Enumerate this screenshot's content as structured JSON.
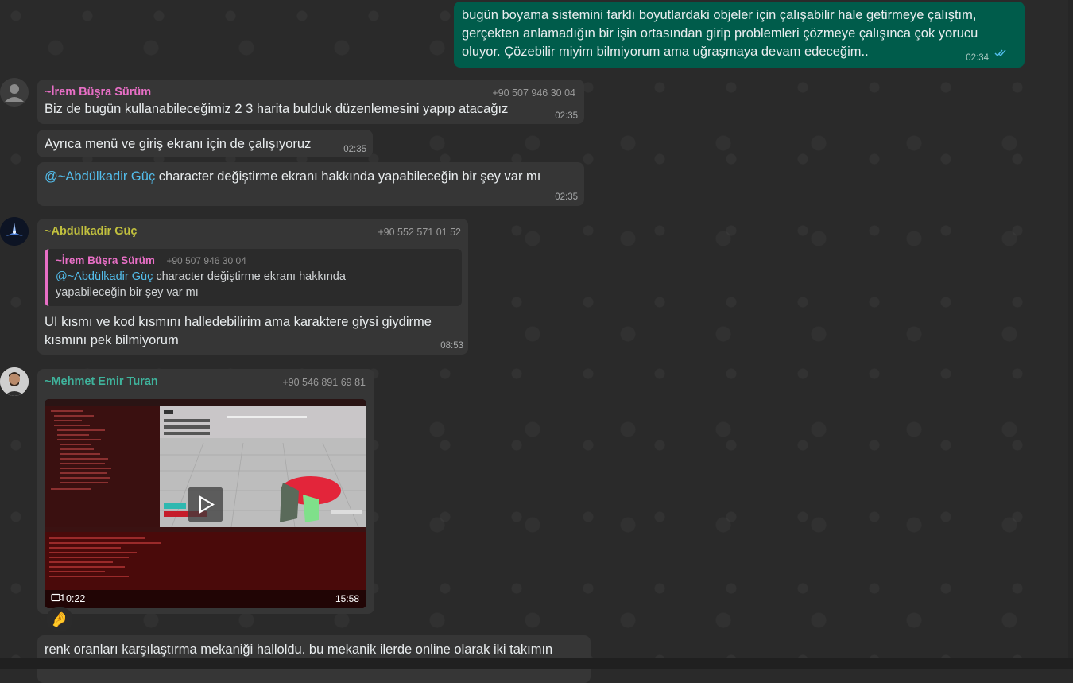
{
  "messages": {
    "out1": {
      "lines": [
        "bugün boyama sistemini farklı boyutlardaki objeler için çalışabilir hale getirmeye çalıştım,",
        "gerçekten anlamadığın bir işin ortasından girip problemleri çözmeye çalışınca çok yorucu",
        "oluyor. Çözebilir miyim bilmiyorum ama uğraşmaya devam edeceğim.."
      ],
      "time": "02:34"
    },
    "irem1": {
      "sender": "~İrem Büşra Sürüm",
      "phone": "+90 507 946 30 04",
      "text": "Biz de bugün kullanabileceğimiz 2 3 harita bulduk düzenlemesini yapıp atacağız",
      "time": "02:35"
    },
    "irem2": {
      "text": "Ayrıca menü ve giriş ekranı için de çalışıyoruz",
      "time": "02:35"
    },
    "irem3": {
      "mention": "@~Abdülkadir Güç",
      "text": " character değiştirme ekranı hakkında yapabileceğin bir şey var mı",
      "time": "02:35"
    },
    "abdul1": {
      "sender": "~Abdülkadir Güç",
      "phone": "+90 552 571 01 52",
      "quote": {
        "sender": "~İrem Büşra Sürüm",
        "phone": "+90 507 946 30 04",
        "mention": "@~Abdülkadir Güç",
        "line1": " character değiştirme ekranı hakkında",
        "line2": "yapabileceğin bir şey var mı"
      },
      "line1": "UI kısmı ve kod kısmını halledebilirim ama karaktere giysi giydirme",
      "line2": "kısmını pek bilmiyorum",
      "time": "08:53"
    },
    "mehmet1": {
      "sender": "~Mehmet Emir Turan",
      "phone": "+90 546 891 69 81",
      "video_duration": "0:22",
      "time": "15:58",
      "reaction": "🤌"
    },
    "partial": {
      "text": "renk oranları karşılaştırma mekaniği halloldu. bu mekanik ilerde online olarak iki takımın"
    }
  },
  "colors": {
    "irem": "#e86fc6",
    "abdul": "#c1c03e",
    "mehmet": "#3fb39c",
    "outgoing": "#005c4b",
    "incoming": "#363636",
    "mention": "#53bdeb",
    "read_ticks": "#53bdeb"
  },
  "icons": [
    "default-avatar-icon",
    "read-ticks-icon",
    "play-icon",
    "video-camera-icon"
  ]
}
